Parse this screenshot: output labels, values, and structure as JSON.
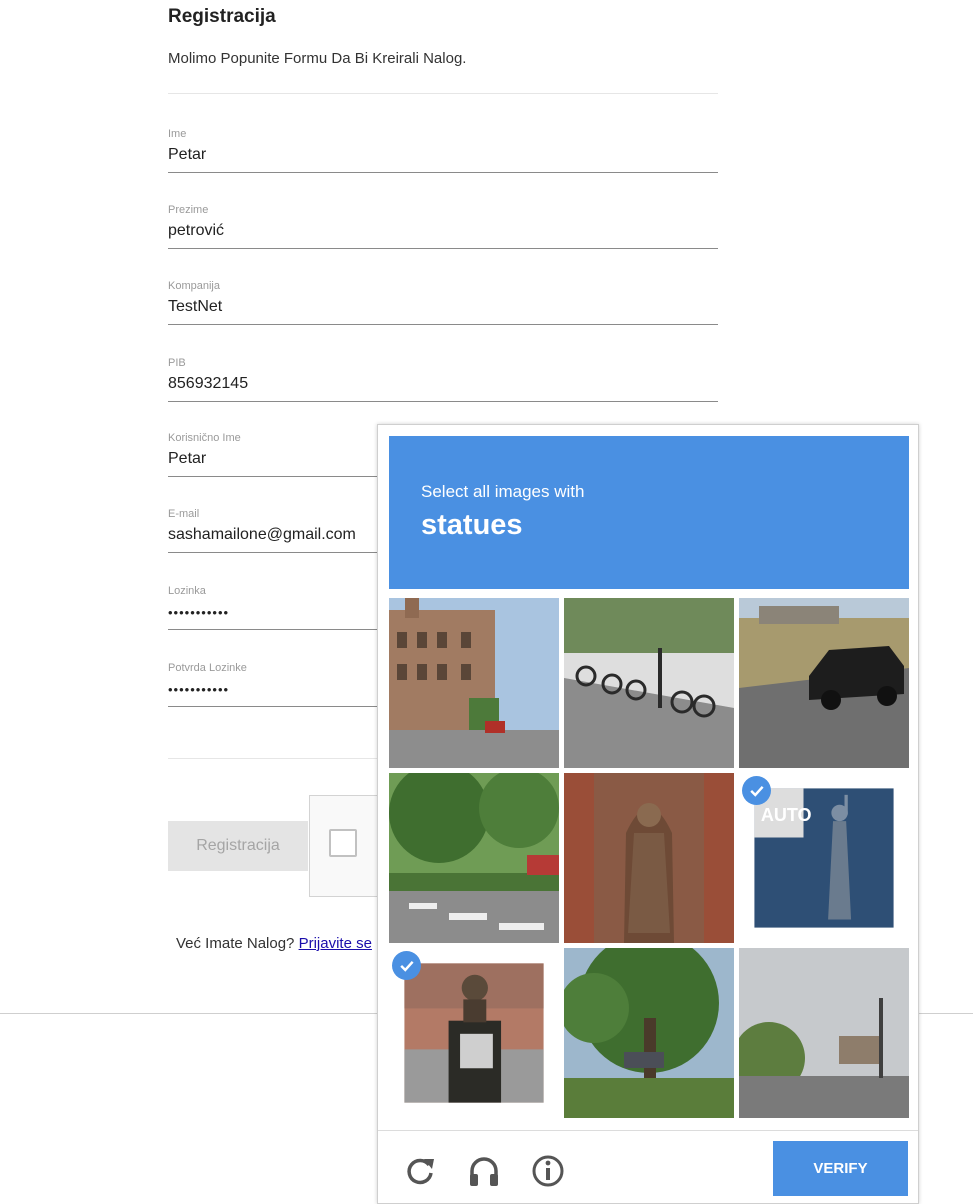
{
  "form": {
    "title": "Registracija",
    "subtitle": "Molimo Popunite Formu Da Bi Kreirali Nalog.",
    "fields": [
      {
        "label": "Ime",
        "value": "Petar"
      },
      {
        "label": "Prezime",
        "value": "petrović"
      },
      {
        "label": "Kompanija",
        "value": "TestNet"
      },
      {
        "label": "PIB",
        "value": "856932145"
      },
      {
        "label": "Korisnično Ime",
        "value": "Petar"
      },
      {
        "label": "E-mail",
        "value": "sashamailone@gmail.com"
      },
      {
        "label": "Lozinka",
        "value": "•••••••••••"
      },
      {
        "label": "Potvrda Lozinke",
        "value": "•••••••••••"
      }
    ],
    "submit_label": "Registracija",
    "already_text": "Već Imate Nalog?",
    "login_link": "Prijavite se"
  },
  "captcha": {
    "instruction": "Select all images with",
    "target": "statues",
    "tiles": [
      {
        "content": "street-building",
        "selected": false
      },
      {
        "content": "bicycles-sidewalk",
        "selected": false
      },
      {
        "content": "black-suv",
        "selected": false
      },
      {
        "content": "tree-crosswalk",
        "selected": false
      },
      {
        "content": "statue-brick-niche",
        "selected": false
      },
      {
        "content": "statue-billboard",
        "selected": true
      },
      {
        "content": "bust-statue",
        "selected": true
      },
      {
        "content": "large-tree",
        "selected": false
      },
      {
        "content": "road-sky",
        "selected": false
      }
    ],
    "verify_label": "VERIFY",
    "icons": [
      "reload-icon",
      "audio-icon",
      "info-icon"
    ],
    "accent_color": "#4a90e2"
  }
}
